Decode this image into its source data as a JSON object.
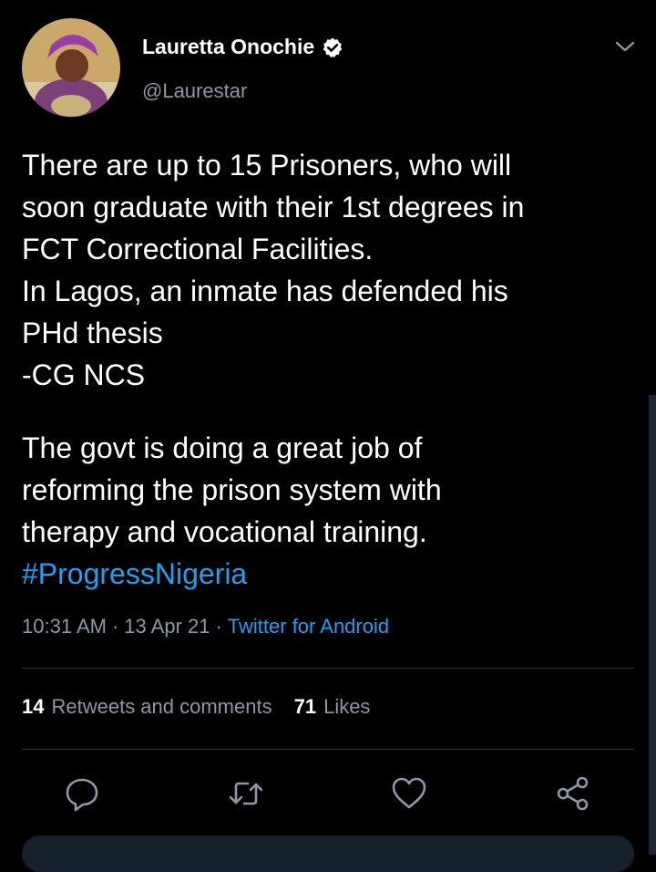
{
  "author": {
    "name": "Lauretta Onochie",
    "handle": "@Laurestar",
    "verified": true
  },
  "tweet": {
    "lines": [
      "There are up to 15 Prisoners, who will",
      "soon graduate with their 1st degrees in",
      "FCT Correctional Facilities.",
      "In Lagos, an inmate has defended his",
      "PHd thesis",
      "-CG NCS"
    ],
    "lines2": [
      "The govt is doing a great job of",
      "reforming the prison system with",
      "therapy and vocational training."
    ],
    "hashtag": "#ProgressNigeria",
    "time": "10:31 AM",
    "date": "13 Apr 21",
    "separator": "·",
    "source": "Twitter for Android"
  },
  "stats": {
    "retweets_count": "14",
    "retweets_label": "Retweets and comments",
    "likes_count": "71",
    "likes_label": "Likes"
  },
  "icons": {
    "verified": "verified-badge-icon",
    "menu": "chevron-down-icon",
    "reply": "reply-icon",
    "retweet": "retweet-icon",
    "like": "heart-icon",
    "share": "share-icon"
  },
  "colors": {
    "background": "#000000",
    "text": "#ffffff",
    "secondary": "#8b98a5",
    "accent": "#1da1f2",
    "divider": "#2f3336"
  }
}
